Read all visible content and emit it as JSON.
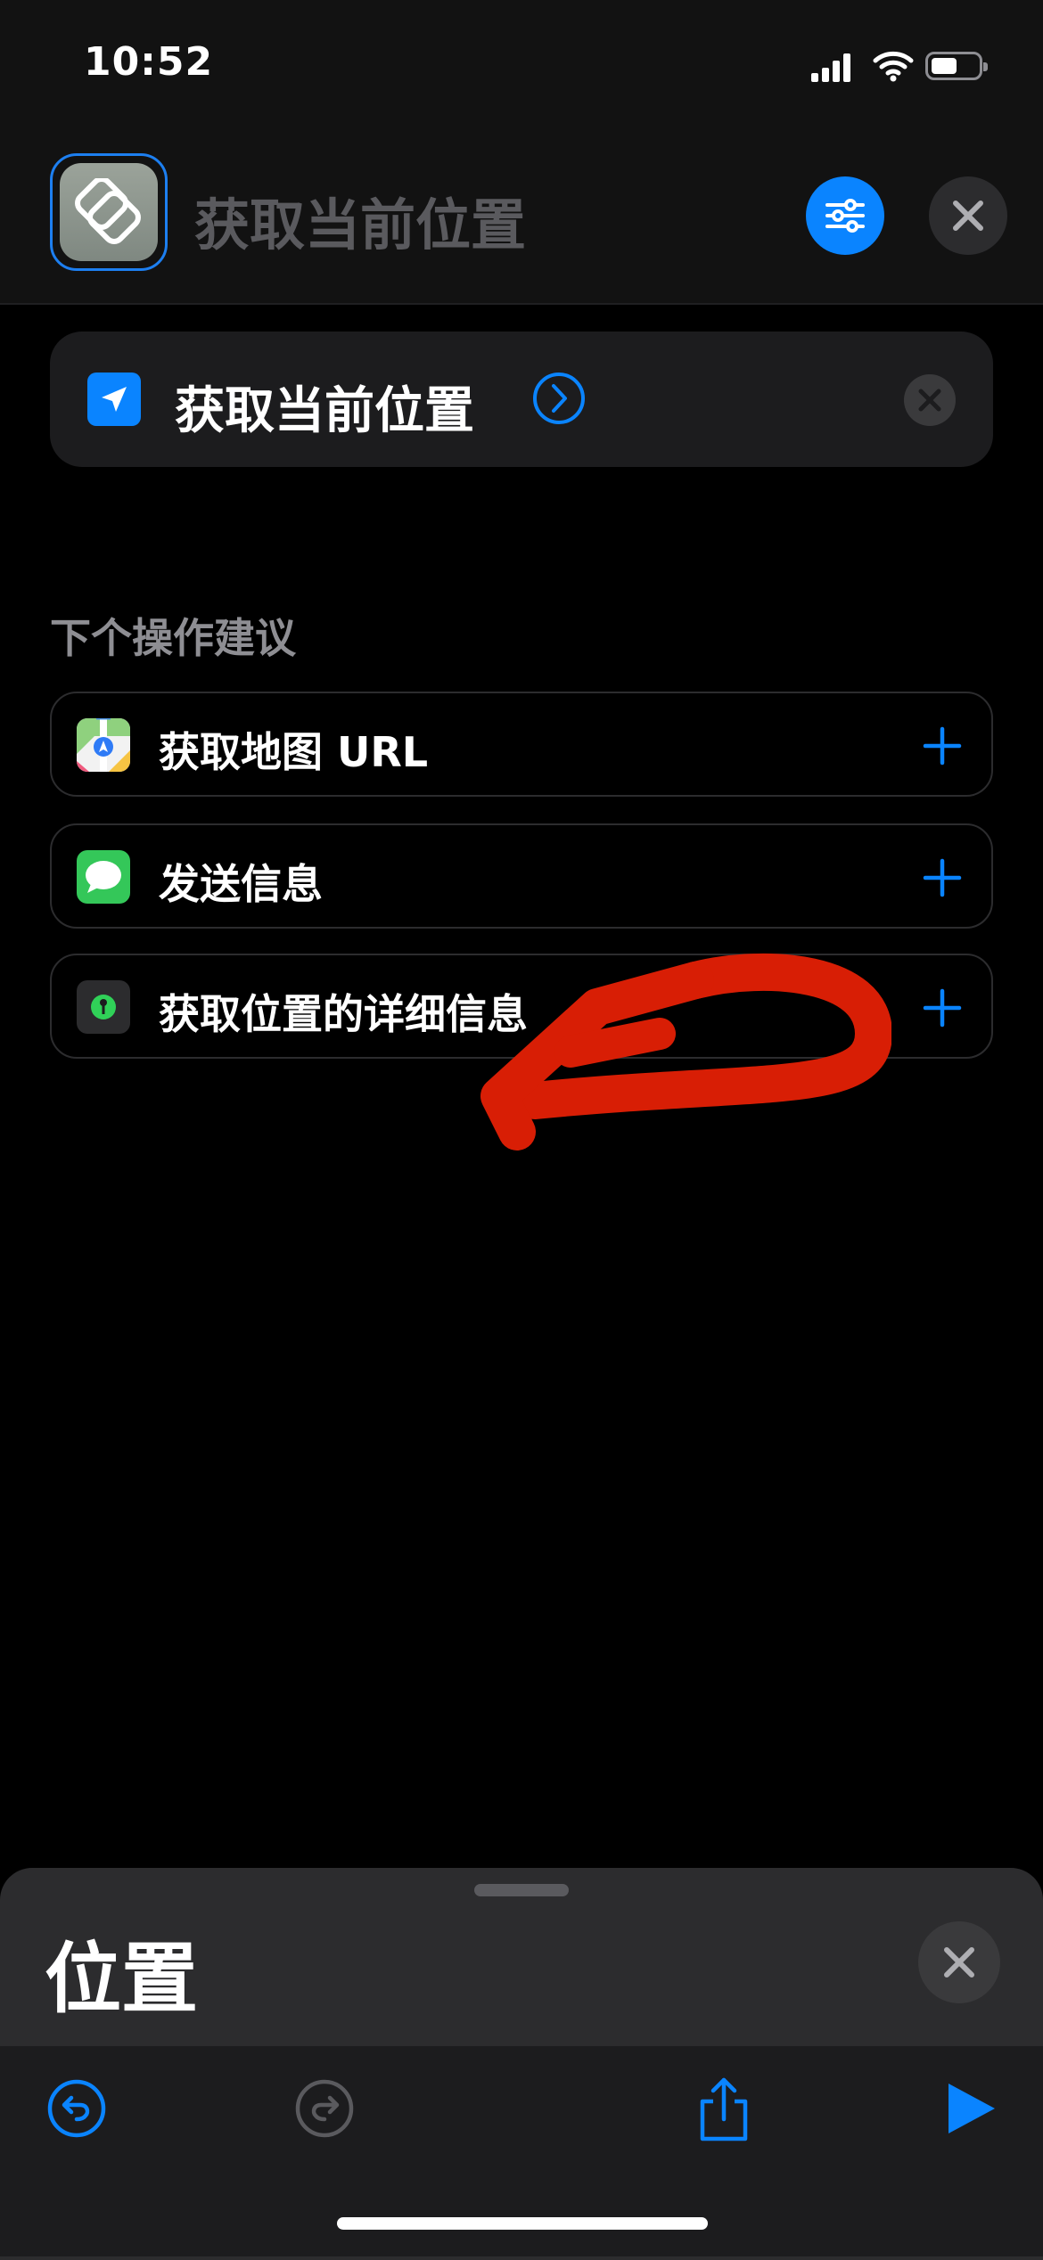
{
  "status_bar": {
    "time": "10:52",
    "icons": [
      "signal-icon",
      "wifi-icon",
      "battery-icon"
    ]
  },
  "header": {
    "app_icon": "shortcuts-icon",
    "title": "获取当前位置",
    "filter_icon": "sliders-icon",
    "close_icon": "close-icon"
  },
  "action_card": {
    "icon": "location-arrow-icon",
    "label": "获取当前位置",
    "chevron_icon": "chevron-right-circle-icon",
    "remove_icon": "close-icon"
  },
  "suggestions": {
    "header": "下个操作建议",
    "items": [
      {
        "label": "获取地图 URL",
        "icon": "maps-icon"
      },
      {
        "label": "发送信息",
        "icon": "messages-icon"
      },
      {
        "label": "获取位置的详细信息",
        "icon": "location-pin-icon"
      }
    ]
  },
  "annotation": {
    "color": "#d81e05",
    "icon": "hand-drawn-arrow"
  },
  "sheet": {
    "title": "位置",
    "close_icon": "close-icon"
  },
  "toolbar": {
    "items": [
      "undo-icon",
      "redo-icon",
      "share-icon",
      "play-icon"
    ]
  },
  "colors": {
    "accent": "#0a84ff",
    "background": "#000000",
    "card": "#1c1c1e"
  }
}
